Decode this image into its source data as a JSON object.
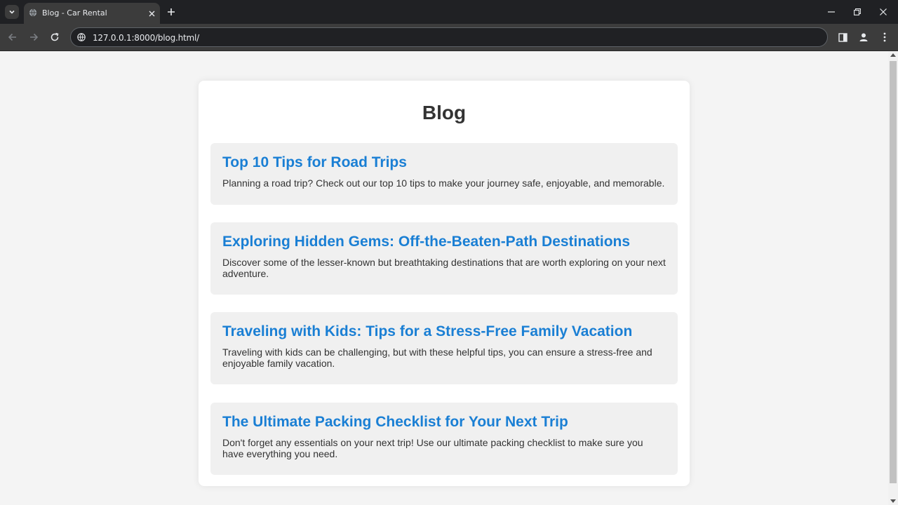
{
  "browser": {
    "tab_title": "Blog - Car Rental",
    "url": "127.0.0.1:8000/blog.html/"
  },
  "page": {
    "title": "Blog",
    "accent_color": "#1a7fd4",
    "posts": [
      {
        "title": "Top 10 Tips for Road Trips",
        "excerpt": "Planning a road trip? Check out our top 10 tips to make your journey safe, enjoyable, and memorable."
      },
      {
        "title": "Exploring Hidden Gems: Off-the-Beaten-Path Destinations",
        "excerpt": "Discover some of the lesser-known but breathtaking destinations that are worth exploring on your next adventure."
      },
      {
        "title": "Traveling with Kids: Tips for a Stress-Free Family Vacation",
        "excerpt": "Traveling with kids can be challenging, but with these helpful tips, you can ensure a stress-free and enjoyable family vacation."
      },
      {
        "title": "The Ultimate Packing Checklist for Your Next Trip",
        "excerpt": "Don't forget any essentials on your next trip! Use our ultimate packing checklist to make sure you have everything you need."
      }
    ]
  },
  "icons": {
    "tab_search": "chevron-down-icon",
    "favicon": "globe-icon",
    "tab_close": "close-icon",
    "new_tab": "plus-icon",
    "minimize": "minimize-icon",
    "restore": "restore-icon",
    "close_window": "close-icon",
    "back": "arrow-left-icon",
    "forward": "arrow-right-icon",
    "reload": "reload-icon",
    "site_info": "info-icon",
    "side_panel": "side-panel-icon",
    "profile": "profile-icon",
    "menu": "kebab-menu-icon"
  }
}
